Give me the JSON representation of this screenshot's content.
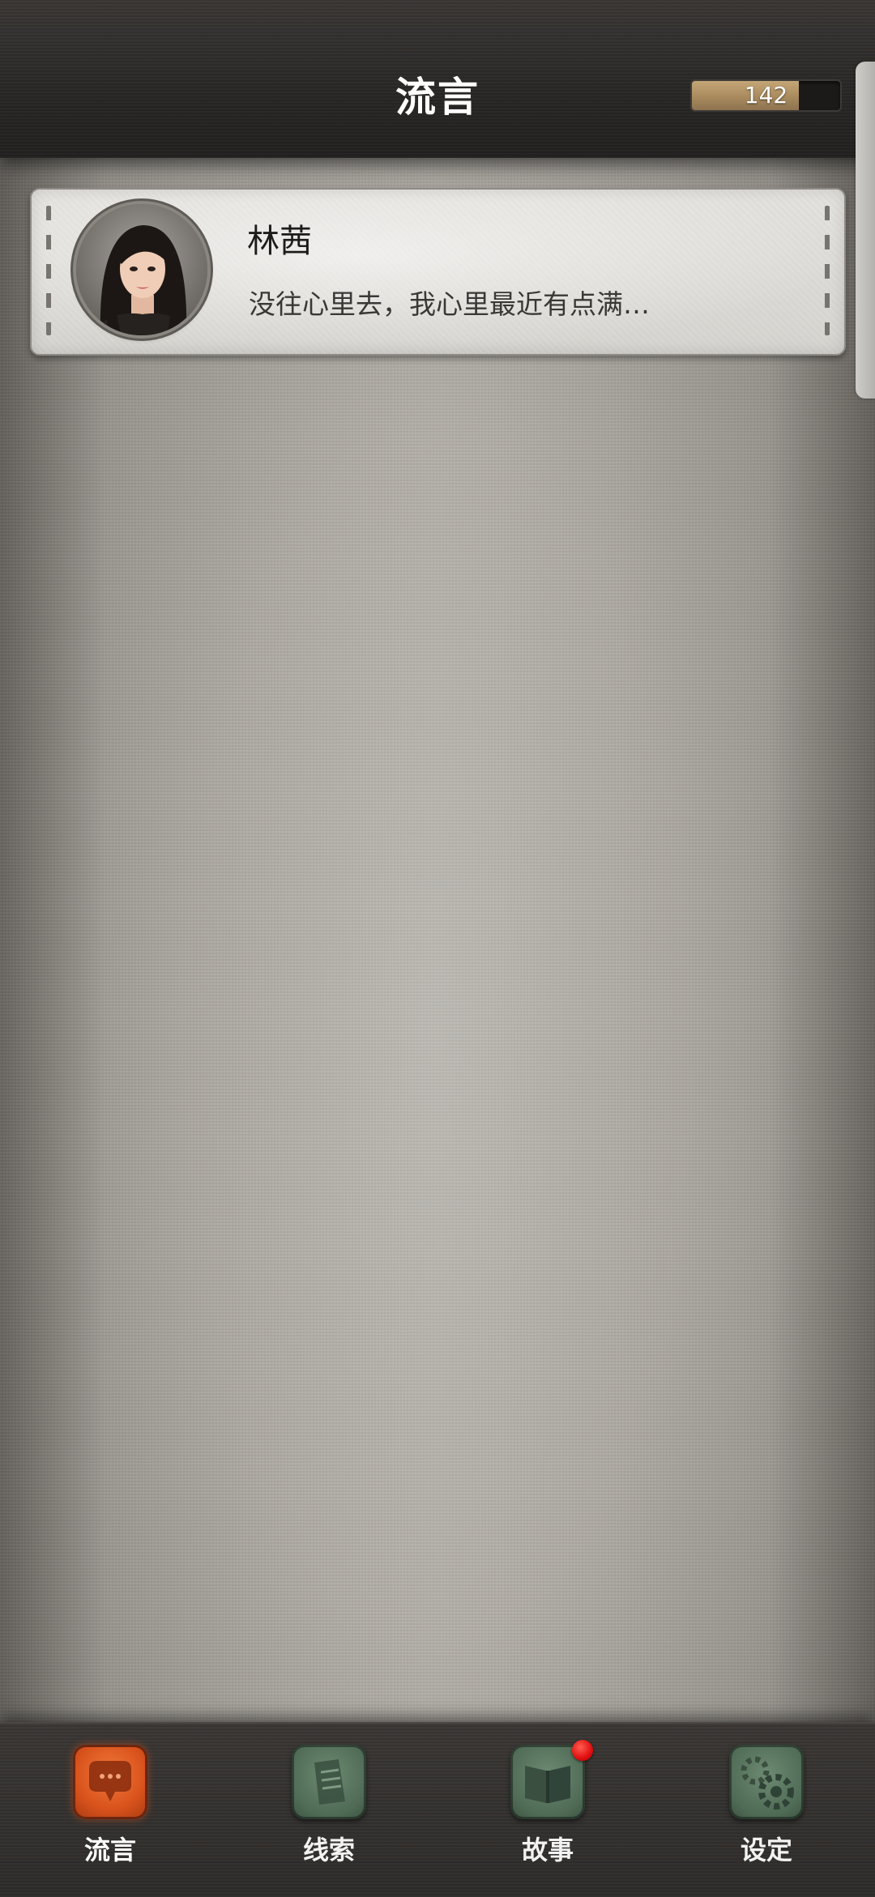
{
  "header": {
    "title": "流言",
    "counter_value": "142",
    "counter_fill_fraction": 0.72
  },
  "messages": [
    {
      "name": "林茜",
      "preview": "没往心里去，我心里最近有点满…",
      "avatar_icon": "avatar-woman-portrait"
    }
  ],
  "nav": {
    "items": [
      {
        "label": "流言",
        "icon": "speech-bubble-icon",
        "active": true
      },
      {
        "label": "线索",
        "icon": "document-icon",
        "active": false
      },
      {
        "label": "故事",
        "icon": "book-icon",
        "active": false,
        "badge": true
      },
      {
        "label": "设定",
        "icon": "gear-icon",
        "active": false
      }
    ]
  },
  "colors": {
    "accent_active": "#e0581f",
    "inactive_icon": "#57735d",
    "badge": "#e00f0f",
    "counter_fill": "#b59569"
  }
}
